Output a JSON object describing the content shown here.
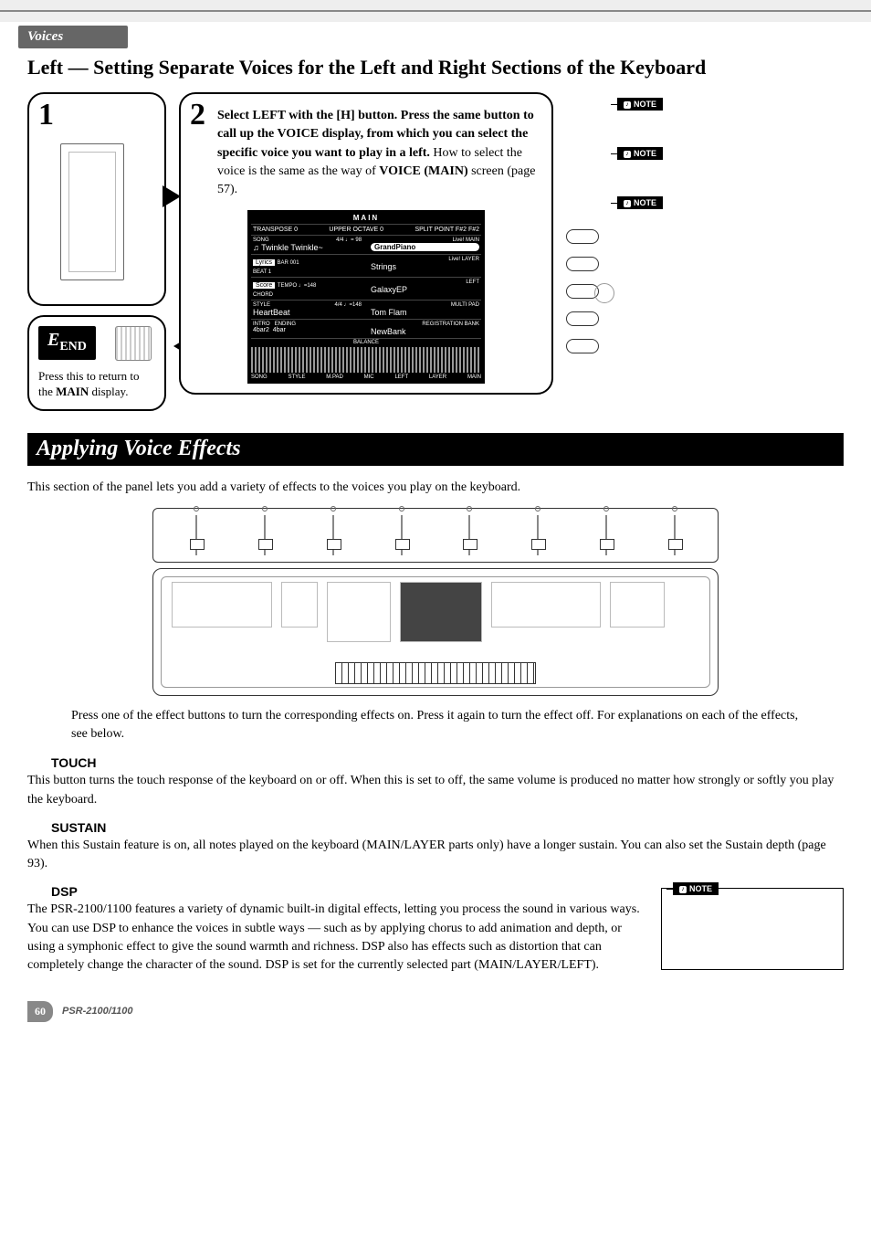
{
  "header": {
    "section": "Voices",
    "title": "Left — Setting Separate Voices for the Left and Right Sections of the Keyboard"
  },
  "step1": {
    "num": "1"
  },
  "step2": {
    "num": "2",
    "lead_bold": "Select LEFT with the [H] button. Press the same button to call up the VOICE display, from which you can select the specific voice you want to play in a left.",
    "tail": " How to select the voice is the same as the way of ",
    "voice_main": "VOICE (MAIN)",
    "page_ref": " screen (page 57)."
  },
  "screen": {
    "title": "MAIN",
    "row1_left": "TRANSPOSE  0",
    "row1_mid": "UPPER OCTAVE  0",
    "row1_right": "SPLIT POINT  F#2  F#2",
    "song_label": "SONG",
    "song_time": "4/4   ♩= 98",
    "song_name": "♫ Twinkle Twinkle~",
    "main_label": "MAIN",
    "main_voice": "GrandPiano",
    "lyrics_btn": "Lyrics",
    "bar_label": "BAR",
    "bar_val": "001",
    "beat_label": "BEAT",
    "beat_val": "1",
    "layer_label": "LAYER",
    "layer_voice": "Strings",
    "score_btn": "Score",
    "tempo_label": "TEMPO",
    "tempo_val": "♩=148",
    "chord_label": "CHORD",
    "left_label": "LEFT",
    "left_voice": "GalaxyEP",
    "style_label": "STYLE",
    "style_time": "4/4   ♩=148",
    "style_name": "HeartBeat",
    "multipad_label": "MULTI PAD",
    "multipad_name": "Tom Flam",
    "intro_label": "INTRO",
    "intro_val": "4bar2",
    "ending_label": "ENDING",
    "ending_val": "4bar",
    "regbank_label": "REGISTRATION BANK",
    "regbank_name": "NewBank",
    "balance_title": "BALANCE",
    "balance_vals": [
      "○100",
      "○100",
      "○100",
      "100",
      "○100",
      "○100",
      "○100"
    ],
    "balance_labels": [
      "SONG",
      "STYLE",
      "M.PAD",
      "MIC",
      "LEFT",
      "LAYER",
      "MAIN"
    ]
  },
  "end": {
    "label": "END",
    "caption_pre": "Press this to return to the ",
    "caption_bold": "MAIN",
    "caption_post": " display."
  },
  "notes": {
    "n1": "NOTE",
    "n2": "NOTE",
    "n3": "NOTE"
  },
  "banner": "Applying Voice Effects",
  "intro_para": "This section of the panel lets you add a variety of effects to the voices you play on the keyboard.",
  "panel_caption": "Press one of the effect buttons to turn the corresponding effects on. Press it again to turn the effect off. For explanations on each of the effects, see below.",
  "touch": {
    "title": "TOUCH",
    "body": "This button turns the touch response of the keyboard on or off. When this is set to off, the same volume is produced no matter how strongly or softly you play the keyboard."
  },
  "sustain": {
    "title": "SUSTAIN",
    "body": "When this Sustain feature is on, all notes played on the keyboard (MAIN/LAYER parts only) have a longer sustain. You can also set the Sustain depth (page 93)."
  },
  "dsp": {
    "title": "DSP",
    "body": "The PSR-2100/1100 features a variety of dynamic built-in digital effects, letting you process the sound in various ways. You can use DSP to enhance the voices in subtle ways — such as by applying chorus to add animation and depth, or using a symphonic effect to give the sound warmth and richness. DSP also has effects such as distortion that can completely change the character of the sound. DSP is set for the currently selected part (MAIN/LAYER/LEFT).",
    "note": "NOTE"
  },
  "footer": {
    "page": "60",
    "model": "PSR-2100/1100"
  }
}
